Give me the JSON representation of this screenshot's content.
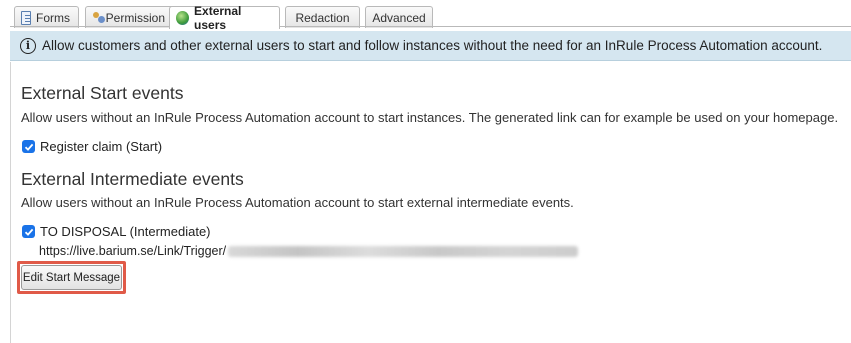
{
  "tabs": [
    {
      "label": "Forms",
      "icon": "forms-icon"
    },
    {
      "label": "Permission",
      "icon": "permission-icon"
    },
    {
      "label": "External users",
      "icon": "globe-icon",
      "active": true
    },
    {
      "label": "Redaction"
    },
    {
      "label": "Advanced"
    }
  ],
  "banner": {
    "icon": "info-icon",
    "text": "Allow customers and other external users to start and follow instances without the need for an InRule Process Automation account."
  },
  "start_events": {
    "heading": "External Start events",
    "description": "Allow users without an InRule Process Automation account to start instances. The generated link can for example be used on your homepage.",
    "items": [
      {
        "label": "Register claim (Start)",
        "checked": true
      }
    ]
  },
  "intermediate_events": {
    "heading": "External Intermediate events",
    "description": "Allow users without an InRule Process Automation account to start external intermediate events.",
    "items": [
      {
        "label": "TO DISPOSAL (Intermediate)",
        "checked": true,
        "url_prefix": "https://live.barium.se/Link/Trigger/"
      }
    ]
  },
  "buttons": {
    "edit_start_message": "Edit Start Message"
  },
  "colors": {
    "banner_bg": "#d5e6f0",
    "checkbox": "#1a73e8",
    "highlight": "#e05a48"
  }
}
